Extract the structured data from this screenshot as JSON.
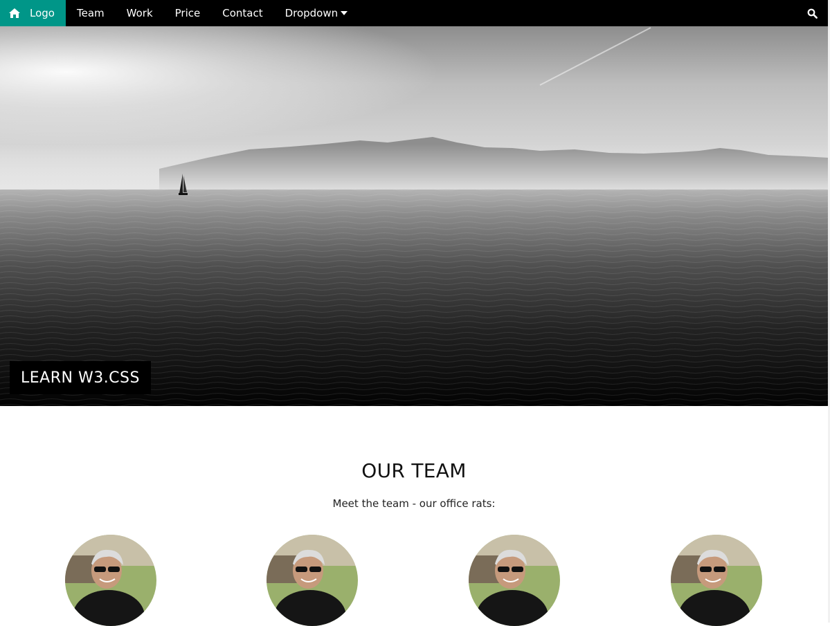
{
  "nav": {
    "logo_label": "Logo",
    "items": [
      {
        "label": "Team"
      },
      {
        "label": "Work"
      },
      {
        "label": "Price"
      },
      {
        "label": "Contact"
      }
    ],
    "dropdown_label": "Dropdown",
    "icons": {
      "home": "home-icon",
      "caret": "caret-down-icon",
      "search": "search-icon"
    },
    "colors": {
      "bar": "#000000",
      "logo_bg": "#009688",
      "text": "#ffffff"
    }
  },
  "hero": {
    "caption": "LEARN W3.CSS",
    "image": "grayscale seascape with sailboat and mountains"
  },
  "team": {
    "title": "OUR TEAM",
    "subtitle": "Meet the team - our office rats:",
    "member_count": 4
  }
}
